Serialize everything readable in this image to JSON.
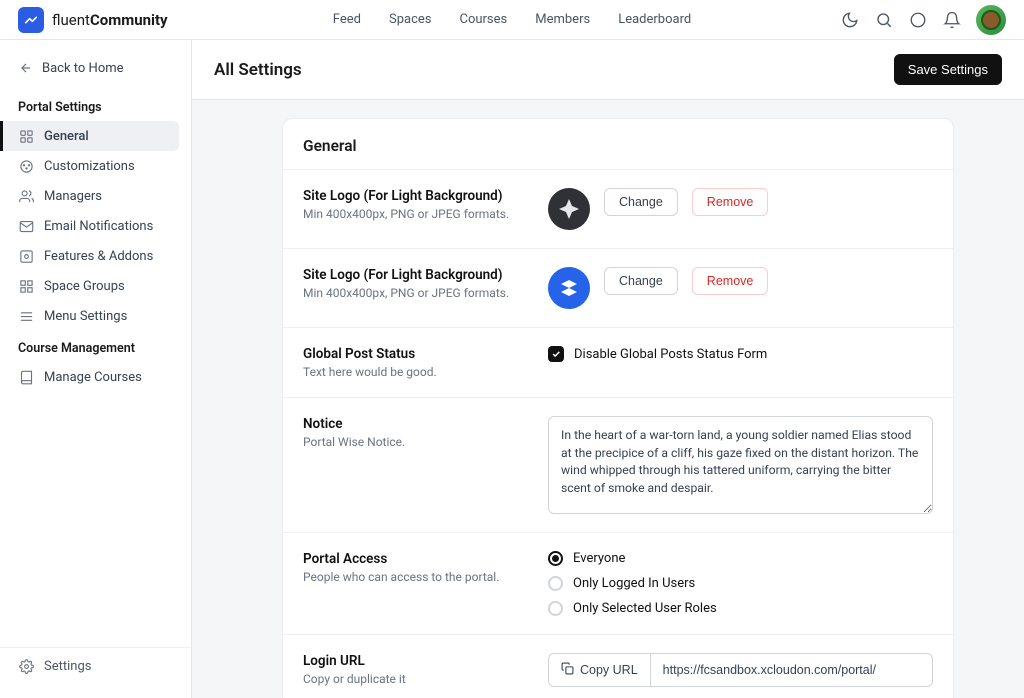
{
  "brand": {
    "name_a": "fluent",
    "name_b": "Community"
  },
  "topnav": [
    "Feed",
    "Spaces",
    "Courses",
    "Members",
    "Leaderboard"
  ],
  "back": "Back to Home",
  "sections": {
    "portal": {
      "head": "Portal Settings",
      "items": [
        "General",
        "Customizations",
        "Managers",
        "Email Notifications",
        "Features & Addons",
        "Space Groups",
        "Menu Settings"
      ]
    },
    "course": {
      "head": "Course Management",
      "items": [
        "Manage Courses"
      ]
    }
  },
  "footer_settings": "Settings",
  "page_title": "All Settings",
  "save_btn": "Save Settings",
  "general": {
    "head": "General",
    "logo1": {
      "label": "Site Logo (For Light Background)",
      "sub": "Min 400x400px, PNG or JPEG formats.",
      "change": "Change",
      "remove": "Remove"
    },
    "logo2": {
      "label": "Site Logo (For Light Background)",
      "sub": "Min 400x400px, PNG or JPEG formats.",
      "change": "Change",
      "remove": "Remove"
    },
    "post_status": {
      "label": "Global Post Status",
      "sub": "Text here would be good.",
      "chk": "Disable Global Posts Status Form"
    },
    "notice": {
      "label": "Notice",
      "sub": "Portal Wise Notice.",
      "value": "In the heart of a war-torn land, a young soldier named Elias stood at the precipice of a cliff, his gaze fixed on the distant horizon. The wind whipped through his tattered uniform, carrying the bitter scent of smoke and despair."
    },
    "access": {
      "label": "Portal Access",
      "sub": "People who can access to the portal.",
      "opts": [
        "Everyone",
        "Only Logged In Users",
        "Only Selected User Roles"
      ]
    },
    "login": {
      "label": "Login URL",
      "sub": "Copy or duplicate it",
      "copy": "Copy URL",
      "url": "https://fcsandbox.xcloudon.com/portal/"
    }
  }
}
